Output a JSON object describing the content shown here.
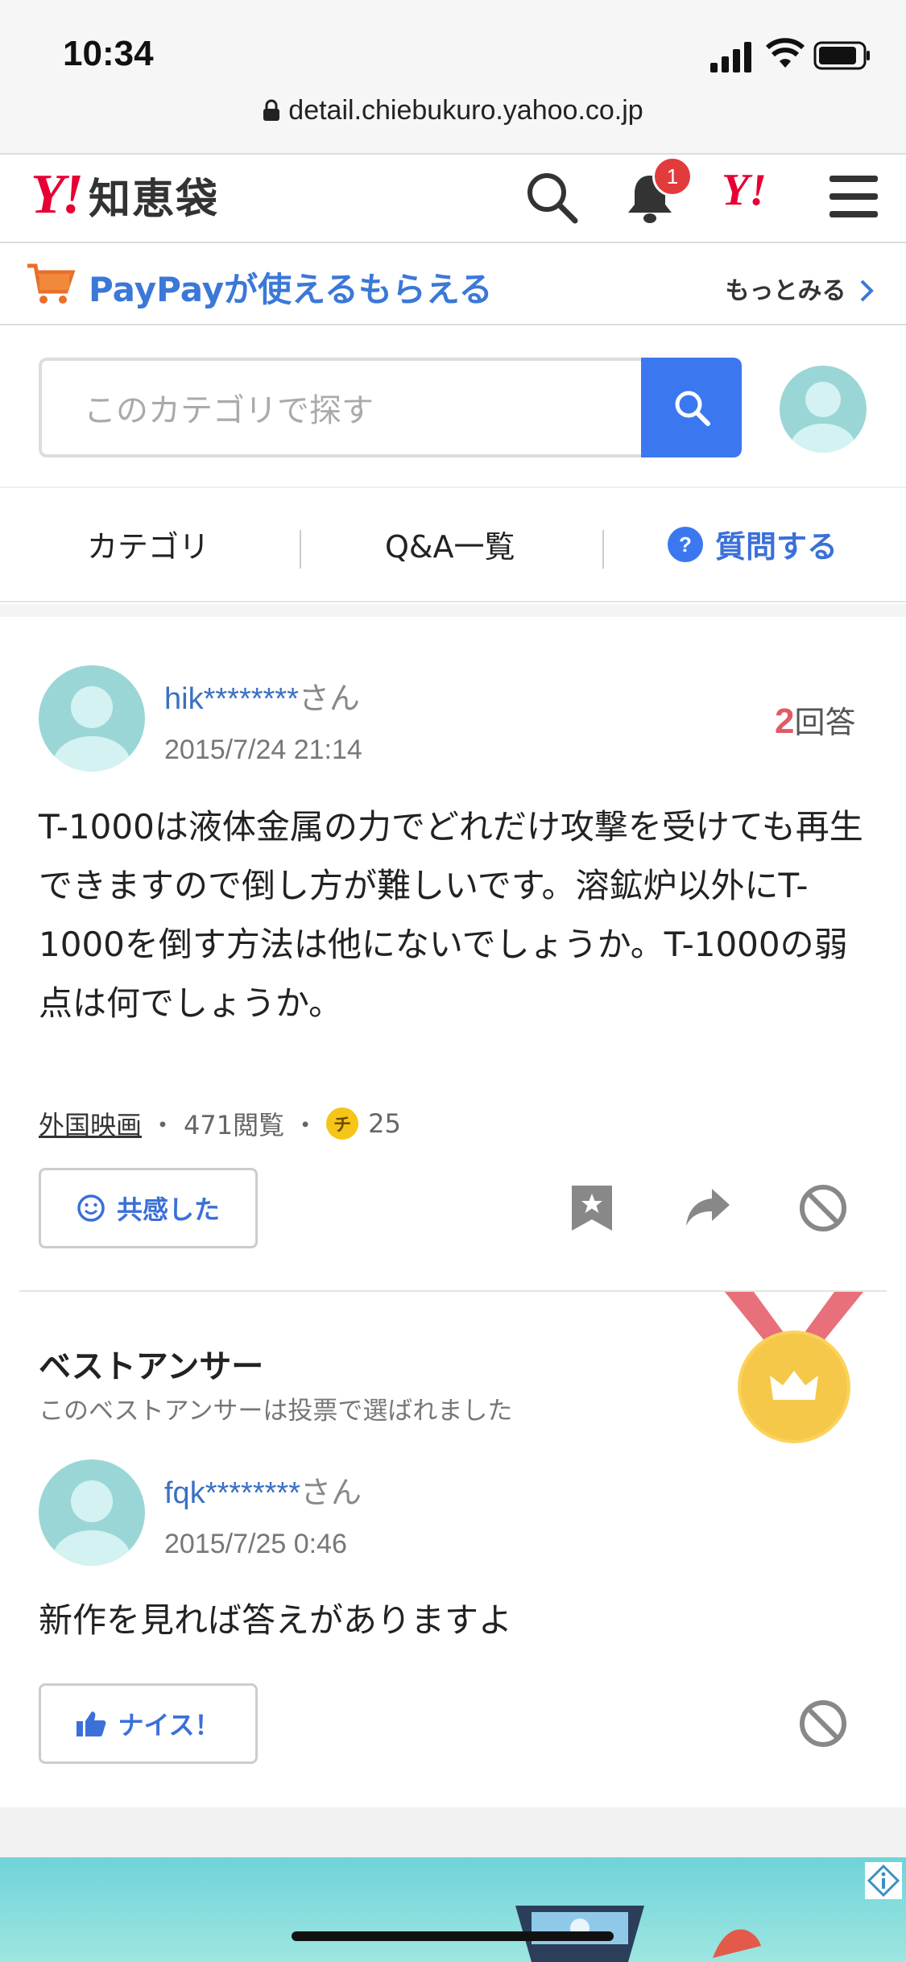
{
  "status": {
    "time": "10:34",
    "url": "detail.chiebukuro.yahoo.co.jp"
  },
  "header": {
    "logo_y": "Y!",
    "logo_text": "知恵袋",
    "notification_count": "1",
    "brand_y": "Y!"
  },
  "promo": {
    "title": "PayPayが使えるもらえる",
    "more": "もっとみる"
  },
  "search": {
    "placeholder": "このカテゴリで探す"
  },
  "nav": {
    "category": "カテゴリ",
    "qa_list": "Q&A一覧",
    "ask": "質問する"
  },
  "question": {
    "user": "hik********",
    "user_suffix": "さん",
    "date": "2015/7/24 21:14",
    "answer_count": "2",
    "answer_label": "回答",
    "body": "T-1000は液体金属の力でどれだけ攻撃を受けても再生できますので倒し方が難しいです。溶鉱炉以外にT-1000を倒す方法は他にないでしょうか。T-1000の弱点は何でしょうか。",
    "category": "外国映画",
    "views": "471閲覧",
    "coin_symbol": "チ",
    "coins": "25",
    "empathy_button": "共感した"
  },
  "best_answer": {
    "title": "ベストアンサー",
    "subtitle": "このベストアンサーは投票で選ばれました",
    "user": "fqk********",
    "user_suffix": "さん",
    "date": "2015/7/25 0:46",
    "body": "新作を見れば答えがありますよ",
    "nice_button": "ナイス！"
  },
  "colors": {
    "brand_red": "#e60033",
    "link_blue": "#3b70c2",
    "search_blue": "#3b78f0",
    "accent_pink": "#e05a67"
  }
}
